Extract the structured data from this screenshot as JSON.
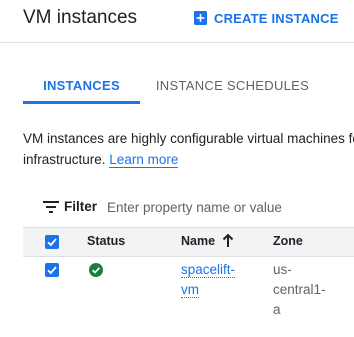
{
  "header": {
    "title": "VM instances",
    "create_label": "CREATE INSTANCE"
  },
  "tabs": [
    {
      "label": "INSTANCES",
      "active": true
    },
    {
      "label": "INSTANCE SCHEDULES",
      "active": false
    }
  ],
  "description": {
    "line1": "VM instances are highly configurable virtual machines for",
    "line2": "infrastructure.",
    "learn_more": "Learn more"
  },
  "filter": {
    "label": "Filter",
    "placeholder": "Enter property name or value"
  },
  "table": {
    "columns": [
      "Status",
      "Name",
      "Zone"
    ],
    "sort_column": "Name",
    "sort_direction": "ascending",
    "rows": [
      {
        "selected": true,
        "status": "running",
        "name_line1": "spacelift-",
        "name_line2": "vm",
        "zone_line1": "us-",
        "zone_line2": "central1-",
        "zone_line3": "a"
      }
    ]
  },
  "colors": {
    "accent": "#1a73e8",
    "status_ok": "#188038",
    "header_bg": "#f1f3f4"
  },
  "icons": [
    "add-box-icon",
    "filter-list-icon",
    "arrow-up-icon",
    "check-circle-icon",
    "checkbox-checked-icon"
  ]
}
